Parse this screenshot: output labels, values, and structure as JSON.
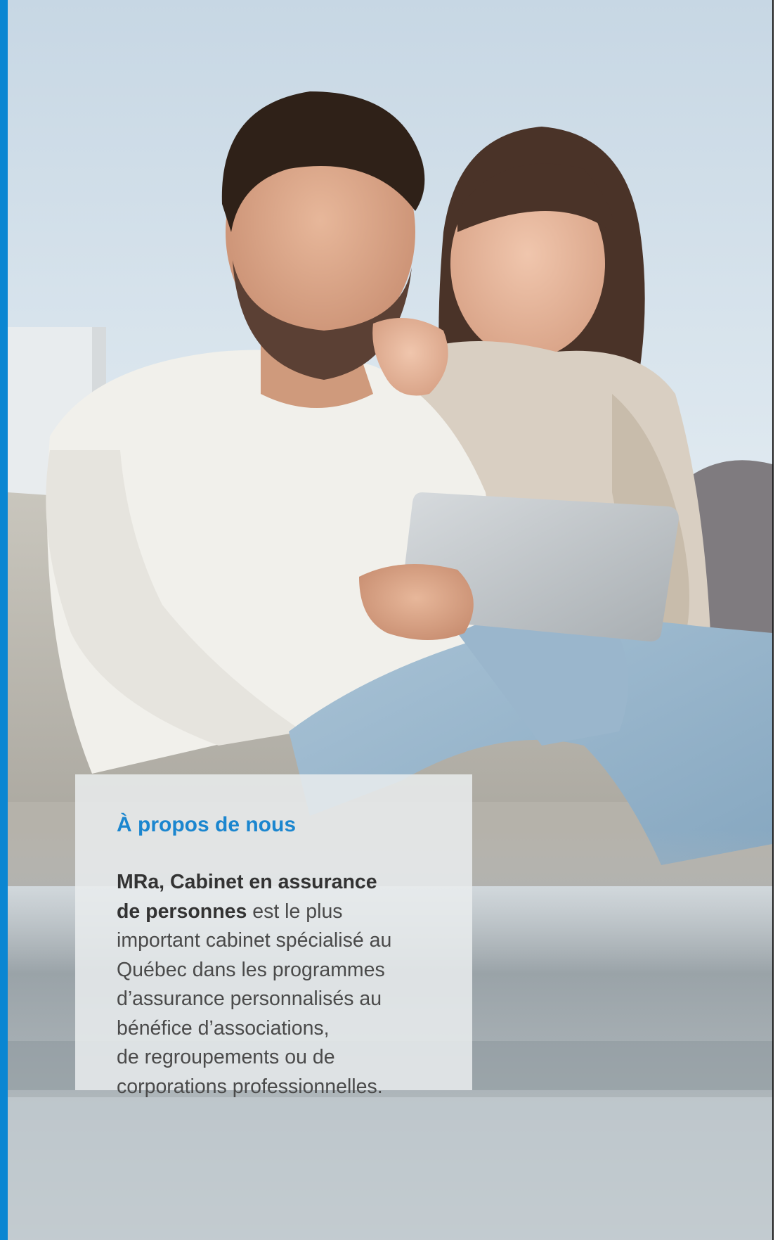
{
  "colors": {
    "accent": "#0a86d2",
    "title": "#1b86cf",
    "body_text": "#4a4a4a",
    "strong_text": "#333333"
  },
  "photo": {
    "icon": "photo-couple-tablet"
  },
  "about": {
    "title": "À propos de nous",
    "company_name_line1": "MRa, Cabinet en assurance",
    "company_name_line2": "de personnes",
    "line2_rest": " est le plus",
    "lines": [
      "important cabinet spécialisé au",
      "Québec dans les programmes",
      "d’assurance personnalisés au",
      "bénéfice d’associations,",
      "de regroupements ou de",
      "corporations professionnelles."
    ]
  }
}
